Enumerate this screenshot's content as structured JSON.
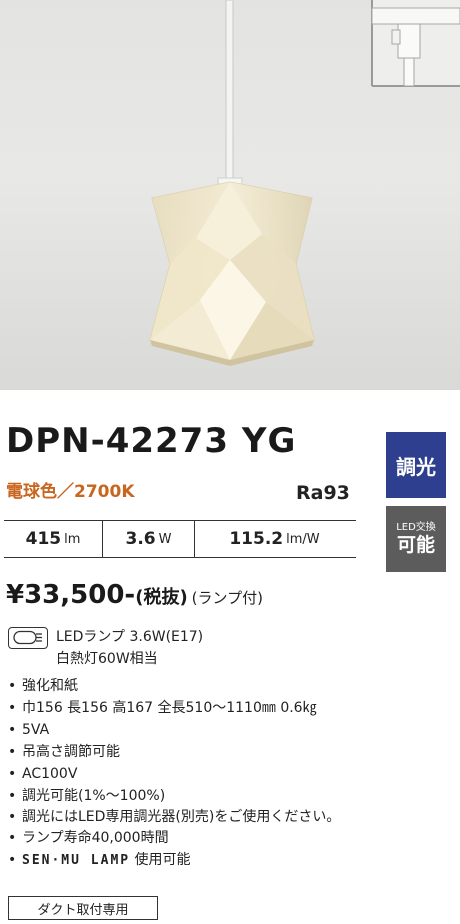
{
  "product": {
    "model": "DPN-42273 YG",
    "color_temp": "電球色／2700K",
    "ra": "Ra93"
  },
  "badges": {
    "dimmable": "調光",
    "led_small": "LED交換",
    "led_big": "可能"
  },
  "specs": [
    {
      "value": "415",
      "unit": "lm"
    },
    {
      "value": "3.6",
      "unit": "W"
    },
    {
      "value": "115.2",
      "unit": "lm/W"
    }
  ],
  "price": {
    "amount": "¥33,500-",
    "tax": "(税抜)",
    "lamp_included": "(ランプ付)"
  },
  "lamp": {
    "line1": "LEDランプ 3.6W(E17)",
    "line2": "白熱灯60W相当"
  },
  "features": [
    "強化和紙",
    "巾156 長156 高167 全長510～1110㎜ 0.6㎏",
    "5VA",
    "吊高さ調節可能",
    "AC100V",
    "調光可能(1%～100%)",
    "調光にはLED専用調光器(別売)をご使用ください。",
    "ランプ寿命40,000時間"
  ],
  "sensmu": {
    "brand": "SEN·MU LAMP",
    "text": "使用可能"
  },
  "footer": {
    "duct": "ダクト取付専用"
  },
  "colors": {
    "color_temp_text": "#c8651e",
    "badge_dim_bg": "#2d3f8e",
    "badge_led_bg": "#5c5c5c"
  },
  "icons": {
    "lamp": "led-bulb-icon",
    "rail": "duct-rail-adapter-icon"
  }
}
